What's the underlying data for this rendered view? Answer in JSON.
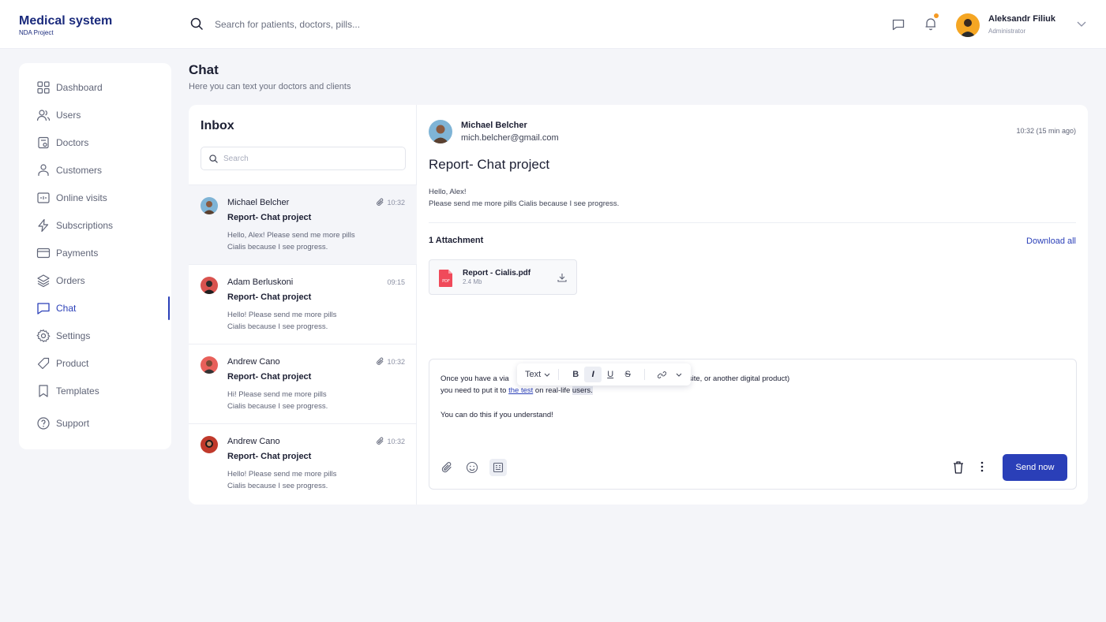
{
  "app": {
    "title": "Medical system",
    "subtitle": "NDA Project"
  },
  "header": {
    "search_placeholder": "Search for patients, doctors, pills...",
    "user": {
      "name": "Aleksandr Filiuk",
      "role": "Administrator"
    },
    "icons": [
      "search-icon",
      "chat-icon",
      "bell-icon",
      "chevron-down-icon"
    ],
    "notification_dot_color": "#f59a23"
  },
  "sidebar": {
    "items": [
      {
        "label": "Dashboard",
        "icon": "grid-icon"
      },
      {
        "label": "Users",
        "icon": "users-icon"
      },
      {
        "label": "Doctors",
        "icon": "clipboard-icon"
      },
      {
        "label": "Customers",
        "icon": "customer-icon"
      },
      {
        "label": "Online visits",
        "icon": "calendar-icon"
      },
      {
        "label": "Subscriptions",
        "icon": "bolt-icon"
      },
      {
        "label": "Payments",
        "icon": "card-icon"
      },
      {
        "label": "Orders",
        "icon": "layers-icon"
      },
      {
        "label": "Chat",
        "icon": "chat-icon",
        "active": true
      },
      {
        "label": "Settings",
        "icon": "gear-icon"
      },
      {
        "label": "Product",
        "icon": "tag-icon"
      },
      {
        "label": "Templates",
        "icon": "bookmark-icon"
      },
      {
        "label": "Support",
        "icon": "help-icon"
      }
    ]
  },
  "page": {
    "title": "Chat",
    "subtitle": "Here you can text your doctors and clients"
  },
  "inbox": {
    "title": "Inbox",
    "search_placeholder": "Search",
    "messages": [
      {
        "name": "Michael Belcher",
        "subject": "Report- Chat project",
        "preview_1": "Hello, Alex! Please send me more pills",
        "preview_2": "Cialis because I see progress.",
        "time": "10:32",
        "attachment": true,
        "selected": true
      },
      {
        "name": "Adam Berluskoni",
        "subject": "Report- Chat project",
        "preview_1": "Hello! Please send me more pills",
        "preview_2": "Cialis because I see progress.",
        "time": "09:15",
        "attachment": false
      },
      {
        "name": "Andrew Cano",
        "subject": "Report- Chat project",
        "preview_1": "Hi! Please send me more pills",
        "preview_2": "Cialis because I see progress.",
        "time": "10:32",
        "attachment": true
      },
      {
        "name": "Andrew Cano",
        "subject": "Report- Chat project",
        "preview_1": "Hello! Please send me more pills",
        "preview_2": "Cialis because I see progress.",
        "time": "10:32",
        "attachment": true
      }
    ]
  },
  "detail": {
    "sender_name": "Michael Belcher",
    "sender_email": "mich.belcher@gmail.com",
    "time": "10:32 (15 min ago)",
    "subject": "Report- Chat project",
    "body_1": "Hello, Alex!",
    "body_2": "Please send me more pills Cialis because I see progress.",
    "attachments_title": "1 Attachment",
    "download_all": "Download all",
    "attachment": {
      "name": "Report - Cialis.pdf",
      "size": "2.4 Mb",
      "type_label": "PDF"
    }
  },
  "composer": {
    "line1_start": "Once you have a via",
    "line1_end": "site, or another digital product)",
    "line2_start": "you need to put it to ",
    "line2_link": "the test",
    "line2_mid": " on real-life ",
    "line2_sel": "users.",
    "line3": "You can do this if you understand!",
    "format": {
      "text_style": "Text",
      "bold": "B",
      "italic": "I",
      "underline": "U",
      "strike": "S"
    },
    "send_label": "Send now"
  },
  "colors": {
    "accent": "#2a3fb8",
    "brand": "#1a2a7c",
    "pdf": "#f04a5a"
  }
}
